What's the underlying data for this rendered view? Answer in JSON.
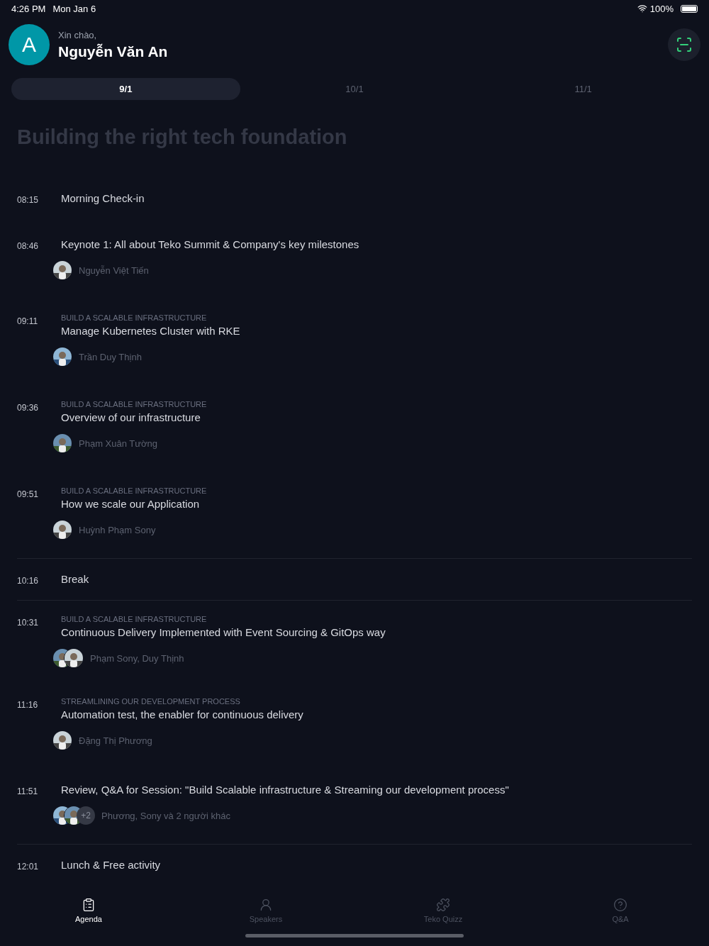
{
  "status_bar": {
    "time": "4:26 PM",
    "date": "Mon Jan 6",
    "battery": "100%"
  },
  "header": {
    "avatar_letter": "A",
    "greeting": "Xin chào,",
    "name": "Nguyễn Văn An"
  },
  "day_tabs": [
    {
      "label": "9/1",
      "selected": true
    },
    {
      "label": "10/1",
      "selected": false
    },
    {
      "label": "11/1",
      "selected": false
    }
  ],
  "section_title": "Building the right tech foundation",
  "agenda": [
    {
      "kind": "session",
      "time": "08:15",
      "title": "Morning Check-in"
    },
    {
      "kind": "session",
      "time": "08:46",
      "title": "Keynote 1: All about Teko Summit & Company's key milestones",
      "speakers": {
        "names": "Nguyễn Việt Tiến"
      }
    },
    {
      "kind": "session",
      "time": "09:11",
      "track": "BUILD A SCALABLE INFRASTRUCTURE",
      "title": "Manage Kubernetes Cluster with RKE",
      "speakers": {
        "names": "Trần Duy Thịnh"
      }
    },
    {
      "kind": "session",
      "time": "09:36",
      "track": "BUILD A SCALABLE INFRASTRUCTURE",
      "title": "Overview of our infrastructure",
      "speakers": {
        "names": "Phạm Xuân Tường"
      }
    },
    {
      "kind": "session",
      "time": "09:51",
      "track": "BUILD A SCALABLE INFRASTRUCTURE",
      "title": "How we scale our Application",
      "speakers": {
        "names": "Huỳnh Phạm Sony"
      }
    },
    {
      "kind": "break",
      "time": "10:16",
      "title": "Break"
    },
    {
      "kind": "session",
      "time": "10:31",
      "track": "BUILD A SCALABLE INFRASTRUCTURE",
      "title": "Continuous Delivery Implemented with Event Sourcing & GitOps way",
      "speakers": {
        "names": "Phạm Sony, Duy Thịnh"
      }
    },
    {
      "kind": "session",
      "time": "11:16",
      "track": "STREAMLINING OUR DEVELOPMENT PROCESS",
      "title": "Automation test, the enabler for continuous delivery",
      "speakers": {
        "names": "Đặng Thị Phương"
      }
    },
    {
      "kind": "session",
      "time": "11:51",
      "title": "Review, Q&A for Session: \"Build Scalable infrastructure & Streaming our development process\"",
      "speakers": {
        "more": "+2",
        "names": "Phương, Sony và 2 người khác"
      }
    },
    {
      "kind": "break",
      "time": "12:01",
      "title": "Lunch & Free activity"
    }
  ],
  "bottom_tabs": [
    {
      "kind": "agenda",
      "label": "Agenda",
      "selected": true
    },
    {
      "kind": "speakers",
      "label": "Speakers",
      "selected": false
    },
    {
      "kind": "quiz",
      "label": "Teko Quizz",
      "selected": false
    },
    {
      "kind": "qa",
      "label": "Q&A",
      "selected": false
    }
  ]
}
